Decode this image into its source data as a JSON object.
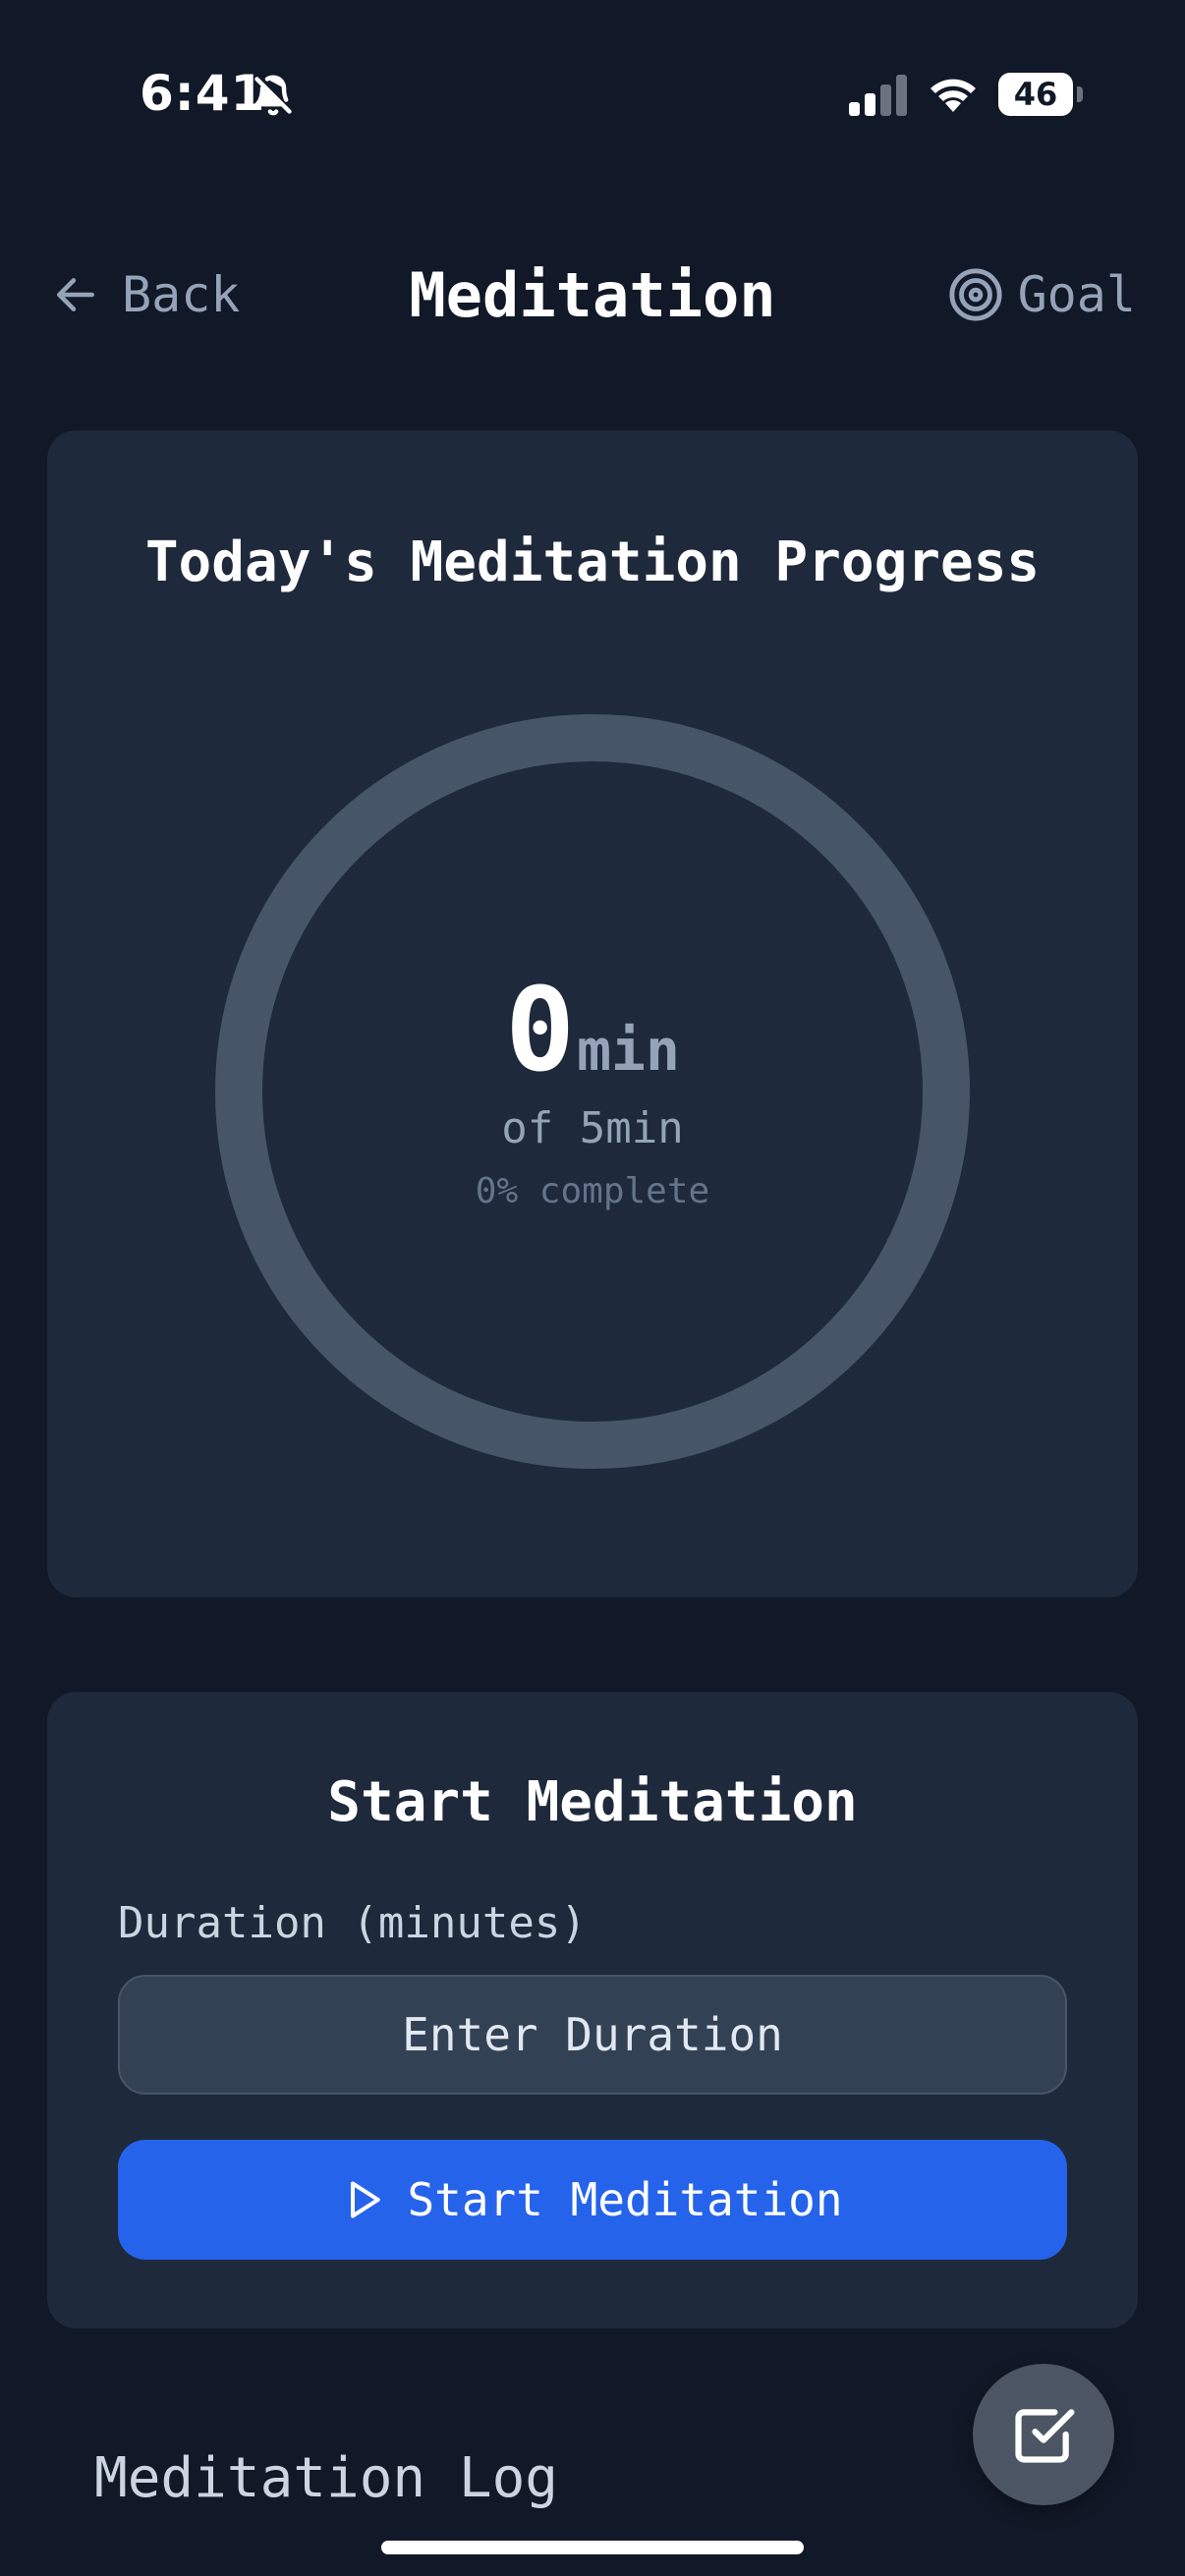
{
  "status_bar": {
    "time": "6:41",
    "battery": "46",
    "icons": [
      "bell-off-icon",
      "signal-icon",
      "wifi-icon",
      "battery-icon"
    ]
  },
  "header": {
    "back_label": "Back",
    "title": "Meditation",
    "goal_label": "Goal",
    "icons": [
      "arrow-left-icon",
      "target-icon"
    ]
  },
  "progress_card": {
    "title": "Today's Meditation Progress",
    "value": "0",
    "unit": "min",
    "goal_text": "of 5min",
    "percent_text": "0% complete",
    "progress_fraction": 0,
    "ring_color": "#475569",
    "ring_fill_color": "#3b82f6"
  },
  "start_card": {
    "title": "Start Meditation",
    "duration_label": "Duration (minutes)",
    "duration_value": "",
    "duration_placeholder": "Enter Duration",
    "start_button_label": "Start Meditation",
    "button_color": "#2563eb",
    "icons": [
      "play-icon"
    ]
  },
  "log": {
    "title": "Meditation Log"
  },
  "fab": {
    "icon": "check-square-icon"
  }
}
